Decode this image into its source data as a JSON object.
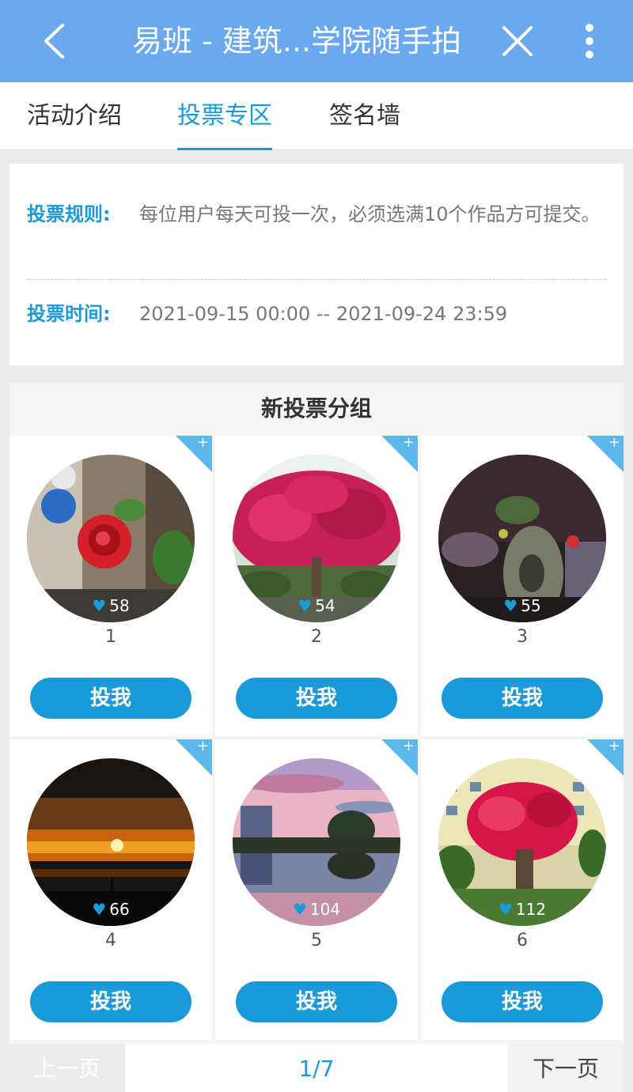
{
  "header": {
    "title": "易班 - 建筑...学院随手拍",
    "back_icon": "chevron-left-icon",
    "close_icon": "close-icon",
    "more_icon": "vertical-dots-icon"
  },
  "tabs": [
    {
      "label": "活动介绍",
      "active": false
    },
    {
      "label": "投票专区",
      "active": true
    },
    {
      "label": "签名墙",
      "active": false
    }
  ],
  "rules": {
    "rule_label": "投票规则:",
    "rule_text": "每位用户每天可投一次，必须选满10个作品方可提交。",
    "time_label": "投票时间:",
    "time_text": "2021-09-15 00:00 -- 2021-09-24 23:59"
  },
  "group": {
    "title": "新投票分组",
    "entries": [
      {
        "number": "1",
        "likes": "58",
        "vote_label": "投我",
        "corner": "+"
      },
      {
        "number": "2",
        "likes": "54",
        "vote_label": "投我",
        "corner": "+"
      },
      {
        "number": "3",
        "likes": "55",
        "vote_label": "投我",
        "corner": "+"
      },
      {
        "number": "4",
        "likes": "66",
        "vote_label": "投我",
        "corner": "+"
      },
      {
        "number": "5",
        "likes": "104",
        "vote_label": "投我",
        "corner": "+"
      },
      {
        "number": "6",
        "likes": "112",
        "vote_label": "投我",
        "corner": "+"
      }
    ]
  },
  "pager": {
    "prev_label": "上一页",
    "page_indicator": "1/7",
    "next_label": "下一页"
  },
  "colors": {
    "header_bg": "#6aa9ef",
    "accent": "#1b9ad9"
  }
}
